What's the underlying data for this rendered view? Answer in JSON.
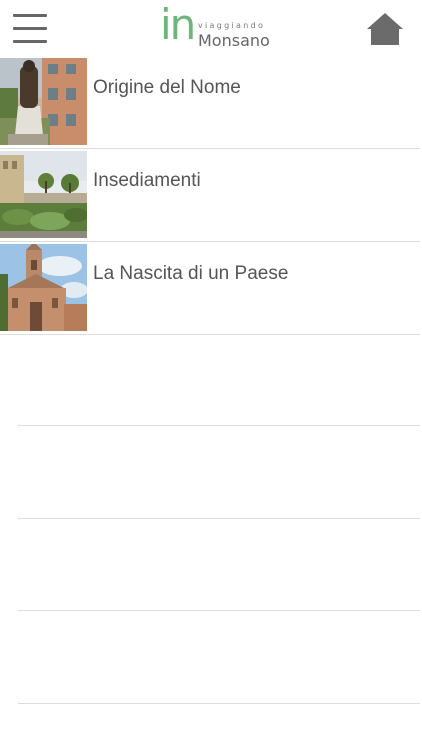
{
  "header": {
    "menu_icon": "hamburger-menu-icon",
    "logo": {
      "prefix": "in",
      "tagline": "viaggiando",
      "name": "Monsano",
      "color": "#6db57a"
    },
    "home_icon": "home-icon"
  },
  "list": {
    "items": [
      {
        "label": "Origine del Nome",
        "image": "statue-photo"
      },
      {
        "label": "Insediamenti",
        "image": "town-walls-photo"
      },
      {
        "label": "La Nascita di un Paese",
        "image": "church-photo"
      }
    ]
  }
}
